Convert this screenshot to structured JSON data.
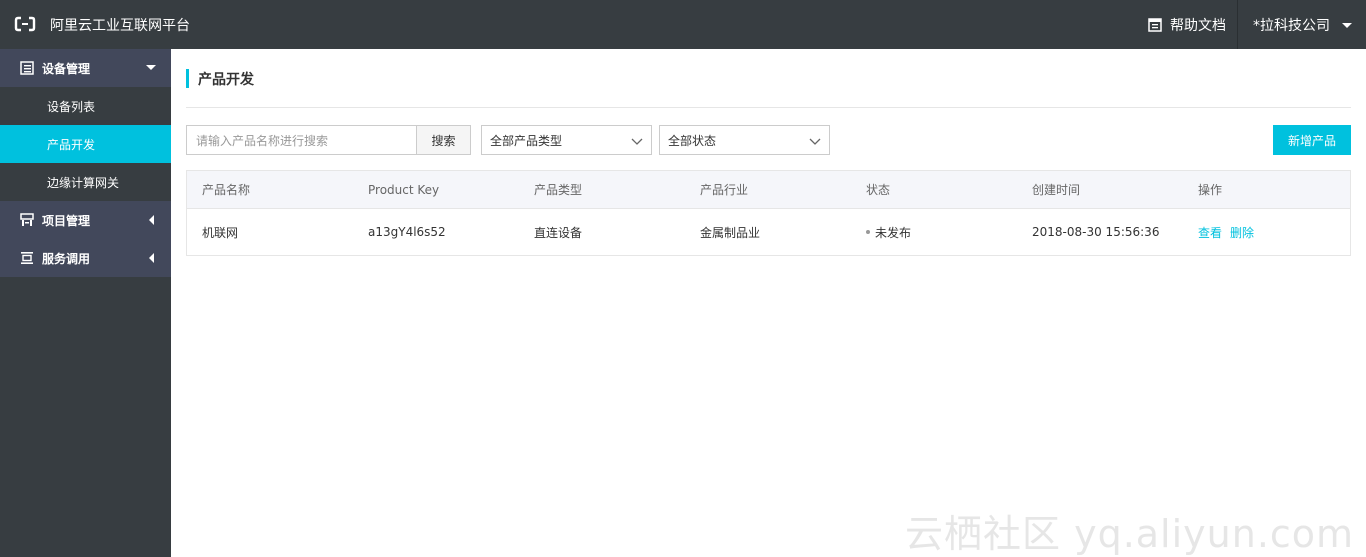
{
  "topbar": {
    "app_title": "阿里云工业互联网平台",
    "help_label": "帮助文档",
    "company_label": "*拉科技公司",
    "bg_color": "#373d41"
  },
  "sidebar": {
    "groups": [
      {
        "label": "设备管理",
        "icon": "device-list-icon",
        "expanded": true,
        "items": [
          {
            "label": "设备列表",
            "active": false
          },
          {
            "label": "产品开发",
            "active": true
          },
          {
            "label": "边缘计算网关",
            "active": false
          }
        ]
      },
      {
        "label": "项目管理",
        "icon": "project-icon",
        "expanded": false
      },
      {
        "label": "服务调用",
        "icon": "service-icon",
        "expanded": false
      }
    ],
    "active_color": "#00c1de"
  },
  "main": {
    "page_title": "产品开发",
    "search": {
      "placeholder": "请输入产品名称进行搜索",
      "button_label": "搜索"
    },
    "filters": {
      "type_selected": "全部产品类型",
      "status_selected": "全部状态"
    },
    "add_button_label": "新增产品",
    "table": {
      "columns": [
        "产品名称",
        "Product Key",
        "产品类型",
        "产品行业",
        "状态",
        "创建时间",
        "操作"
      ],
      "rows": [
        {
          "name": "机联网",
          "product_key": "a13gY4l6s52",
          "type": "直连设备",
          "industry": "金属制品业",
          "status": "未发布",
          "created": "2018-08-30 15:56:36",
          "actions": [
            "查看",
            "删除"
          ]
        }
      ]
    },
    "accent_color": "#00c1de"
  },
  "watermark": "云栖社区 yq.aliyun.com"
}
